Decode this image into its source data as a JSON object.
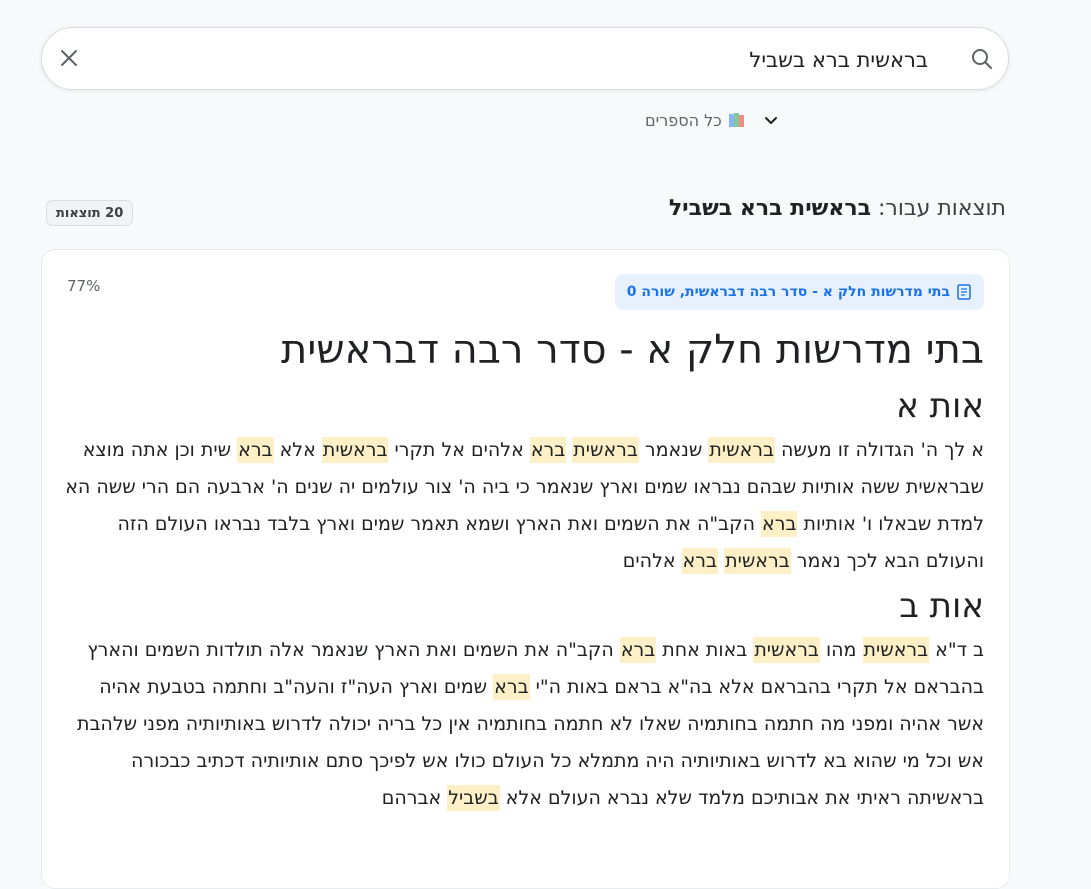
{
  "search": {
    "query": "בראשית ברא בשביל"
  },
  "scope": {
    "label": "כל הספרים"
  },
  "results": {
    "prefix": "תוצאות עבור: ",
    "query": "בראשית ברא בשביל",
    "count_label": "20 תוצאות"
  },
  "result": {
    "score": "77%",
    "source": "בתי מדרשות חלק א - סדר רבה דבראשית, שורה 0",
    "title": "בתי מדרשות חלק א - סדר רבה דבראשית",
    "sections": [
      {
        "heading": "אות א",
        "paragraph": [
          {
            "t": "א לך ה' הגדולה זו מעשה "
          },
          {
            "t": "בראשית",
            "h": true
          },
          {
            "t": " שנאמר "
          },
          {
            "t": "בראשית",
            "h": true
          },
          {
            "t": " "
          },
          {
            "t": "ברא",
            "h": true
          },
          {
            "t": " אלהים אל תקרי "
          },
          {
            "t": "בראשית",
            "h": true
          },
          {
            "t": " אלא "
          },
          {
            "t": "ברא",
            "h": true
          },
          {
            "t": " שית וכן אתה מוצא שבראשית ששה אותיות שבהם נבראו שמים וארץ שנאמר כי ביה ה' צור עולמים יה שנים ה' ארבעה הם הרי ששה הא למדת שבאלו ו' אותיות "
          },
          {
            "t": "ברא",
            "h": true
          },
          {
            "t": " הקב\"ה את השמים ואת הארץ ושמא תאמר שמים וארץ בלבד נבראו העולם הזה והעולם הבא לכך נאמר "
          },
          {
            "t": "בראשית",
            "h": true
          },
          {
            "t": " "
          },
          {
            "t": "ברא",
            "h": true
          },
          {
            "t": " אלהים"
          }
        ]
      },
      {
        "heading": "אות ב",
        "paragraph": [
          {
            "t": "ב ד\"א "
          },
          {
            "t": "בראשית",
            "h": true
          },
          {
            "t": " מהו "
          },
          {
            "t": "בראשית",
            "h": true
          },
          {
            "t": " באות אחת "
          },
          {
            "t": "ברא",
            "h": true
          },
          {
            "t": " הקב\"ה את השמים ואת הארץ שנאמר אלה תולדות השמים והארץ בהבראם אל תקרי בהבראם אלא בה\"א בראם באות ה\"י "
          },
          {
            "t": "ברא",
            "h": true
          },
          {
            "t": " שמים וארץ העה\"ז והעה\"ב וחתמה בטבעת אהיה אשר אהיה ומפני מה חתמה בחותמיה שאלו לא חתמה בחותמיה אין כל בריה יכולה לדרוש באותיותיה מפני שלהבת אש וכל מי שהוא בא לדרוש באותיותיה היה מתמלא כל העולם כולו אש לפיכך סתם אותיותיה דכתיב כבכורה בראשיתה ראיתי את אבותיכם מלמד שלא נברא העולם אלא "
          },
          {
            "t": "בשביל",
            "h": true
          },
          {
            "t": " אברהם"
          }
        ]
      }
    ]
  },
  "colors": {
    "highlight": "#fdf0c6",
    "chip_bg": "#e8f0fe",
    "chip_text": "#1a73e8"
  }
}
